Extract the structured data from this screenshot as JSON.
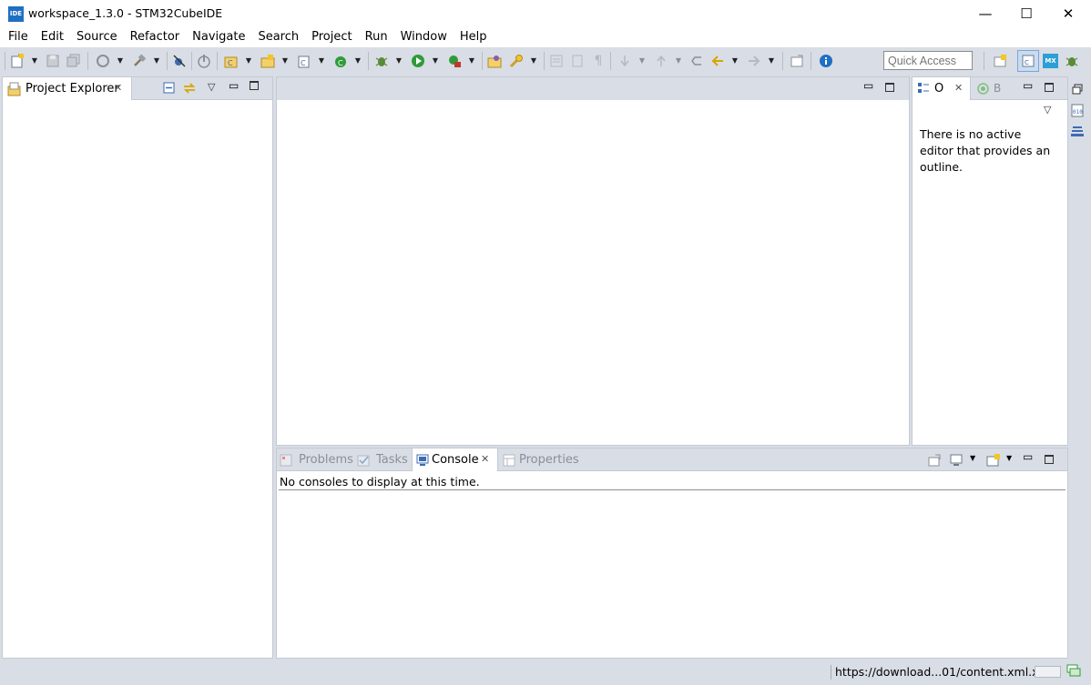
{
  "window": {
    "app_icon_text": "IDE",
    "title": "workspace_1.3.0 - STM32CubeIDE",
    "minimize": "—",
    "maximize": "☐",
    "close": "✕"
  },
  "menu": [
    "File",
    "Edit",
    "Source",
    "Refactor",
    "Navigate",
    "Search",
    "Project",
    "Run",
    "Window",
    "Help"
  ],
  "toolbar": {
    "quick_access_placeholder": "Quick Access",
    "mx_label": "MX"
  },
  "project_explorer": {
    "tab_label": "Project Explorer",
    "close_glyph": "✕"
  },
  "outline": {
    "tab_label": "O",
    "close_glyph": "✕",
    "secondary_tab_label": "B",
    "message": "There is no active editor that provides an outline."
  },
  "bottom_panel": {
    "tabs": [
      {
        "label": "Problems"
      },
      {
        "label": "Tasks"
      },
      {
        "label": "Console"
      },
      {
        "label": "Properties"
      }
    ],
    "close_glyph": "✕",
    "console_message": "No consoles to display at this time."
  },
  "status": {
    "progress_text": "https://download...01/content.xml.xz"
  },
  "colors": {
    "chrome": "#d9dde5",
    "panel_border": "#c4c9d3",
    "app_icon": "#1f6fc3",
    "info": "#1f6fc3",
    "run_green": "#2e9b3b"
  }
}
